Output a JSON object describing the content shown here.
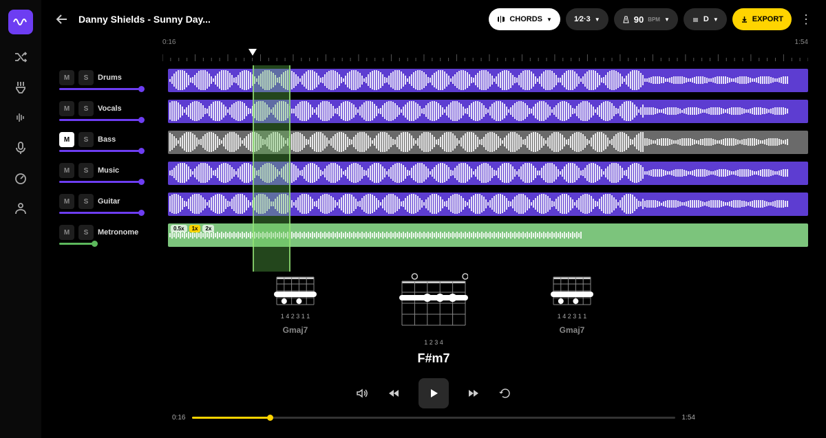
{
  "header": {
    "title": "Danny Shields - Sunny Day...",
    "chords_label": "CHORDS",
    "timesig": "1⁄2·3",
    "bpm_value": "90",
    "bpm_label": "BPM",
    "key": "D",
    "export_label": "EXPORT"
  },
  "timeline": {
    "start": "0:16",
    "end": "1:54",
    "playhead_pct": 14,
    "loop_start_pct": 14,
    "loop_width_pct": 5
  },
  "tracks": [
    {
      "label": "Drums",
      "mute": false,
      "solo": false,
      "color": "purple"
    },
    {
      "label": "Vocals",
      "mute": false,
      "solo": false,
      "color": "purple"
    },
    {
      "label": "Bass",
      "mute": true,
      "solo": false,
      "color": "gray"
    },
    {
      "label": "Music",
      "mute": false,
      "solo": false,
      "color": "purple"
    },
    {
      "label": "Guitar",
      "mute": false,
      "solo": false,
      "color": "purple"
    },
    {
      "label": "Metronome",
      "mute": false,
      "solo": false,
      "color": "green",
      "speeds": [
        "0.5x",
        "1x",
        "2x"
      ]
    }
  ],
  "chords": {
    "prev": {
      "name": "Gmaj7",
      "fingers": "1 4 2 3 1 1"
    },
    "current": {
      "name": "F#m7",
      "fingers": "1   2 3 4"
    },
    "next": {
      "name": "Gmaj7",
      "fingers": "1 4 2 3 1 1"
    }
  },
  "transport": {
    "current": "0:16",
    "duration": "1:54",
    "progress_pct": 16
  }
}
